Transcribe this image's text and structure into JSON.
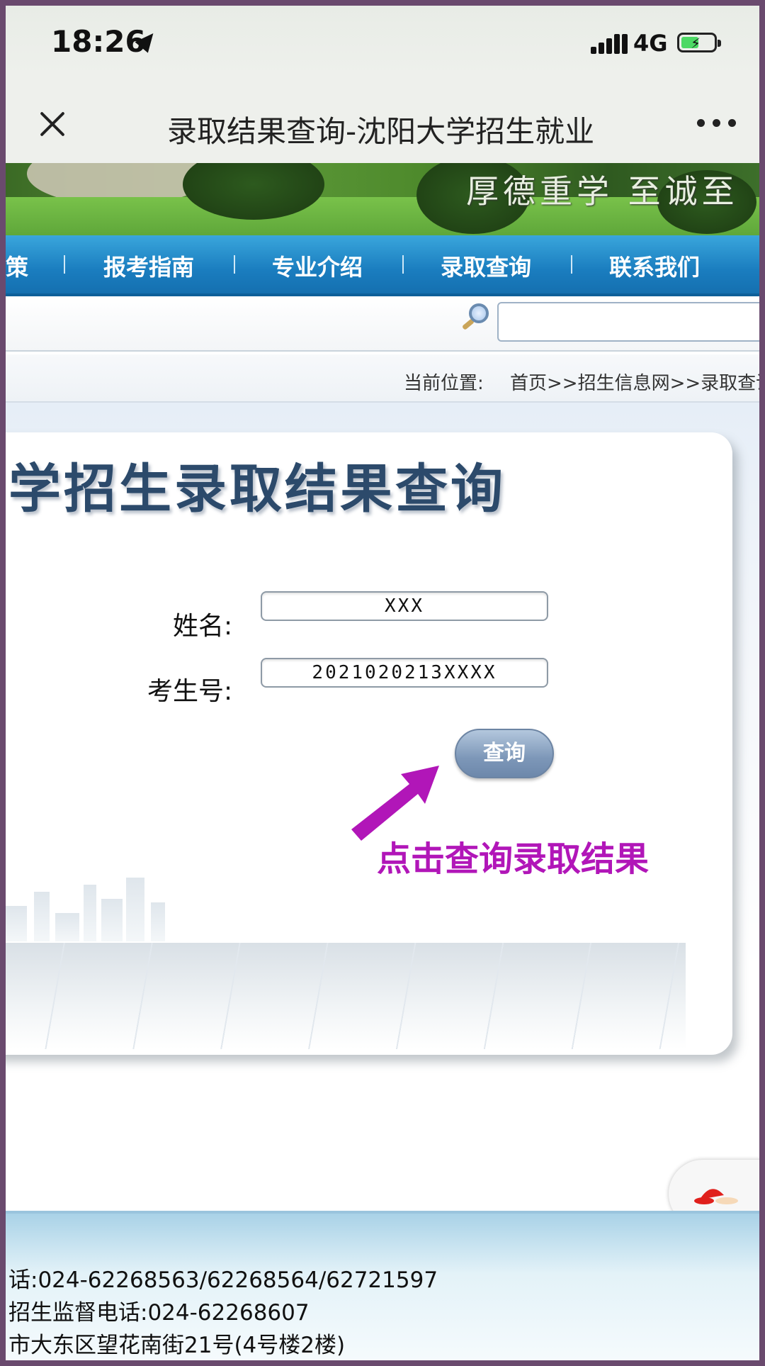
{
  "status_bar": {
    "time": "18:26",
    "network": "4G"
  },
  "nav": {
    "title": "录取结果查询-沈阳大学招生就业"
  },
  "banner": {
    "motto": "厚德重学 至诚至"
  },
  "menu": {
    "items": [
      "策",
      "报考指南",
      "专业介绍",
      "录取查询",
      "联系我们"
    ]
  },
  "breadcrumb": {
    "label": "当前位置:",
    "path": "首页>>招生信息网>>录取查询"
  },
  "form": {
    "heading": "学招生录取结果查询",
    "name_label": "姓名:",
    "name_value": "XXX",
    "id_label": "考生号:",
    "id_value": "2021020213XXXX",
    "submit_label": "查询"
  },
  "annotation": {
    "hint": "点击查询录取结果",
    "color": "#b116b8"
  },
  "footer": {
    "lines": [
      "话:024-62268563/62268564/62721597",
      "招生监督电话:024-62268607",
      "市大东区望花南街21号(4号楼2楼)"
    ]
  },
  "colors": {
    "menu_blue": "#1a7dbf",
    "title_navy": "#2c4a6b"
  }
}
